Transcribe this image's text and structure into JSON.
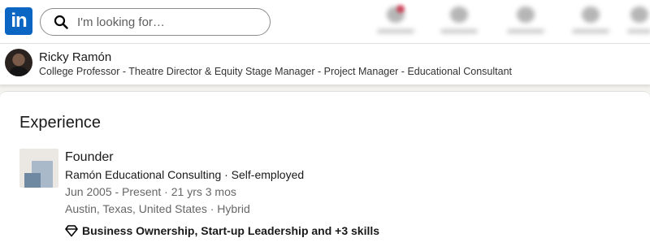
{
  "nav": {
    "logo_text": "in",
    "brand_color": "#0a66c2",
    "search": {
      "placeholder": "I'm looking for…",
      "icon": "search-icon"
    }
  },
  "profile_strip": {
    "name": "Ricky Ramón",
    "headline": "College Professor - Theatre Director & Equity Stage Manager - Project Manager - Educational Consultant"
  },
  "experience": {
    "section_title": "Experience",
    "items": [
      {
        "title": "Founder",
        "company": "Ramón Educational Consulting · Self-employed",
        "dates": "Jun 2005 - Present · 21 yrs 3 mos",
        "location": "Austin, Texas, United States · Hybrid",
        "skills": "Business Ownership, Start-up Leadership and +3 skills",
        "skills_icon": "diamond-icon"
      }
    ]
  }
}
